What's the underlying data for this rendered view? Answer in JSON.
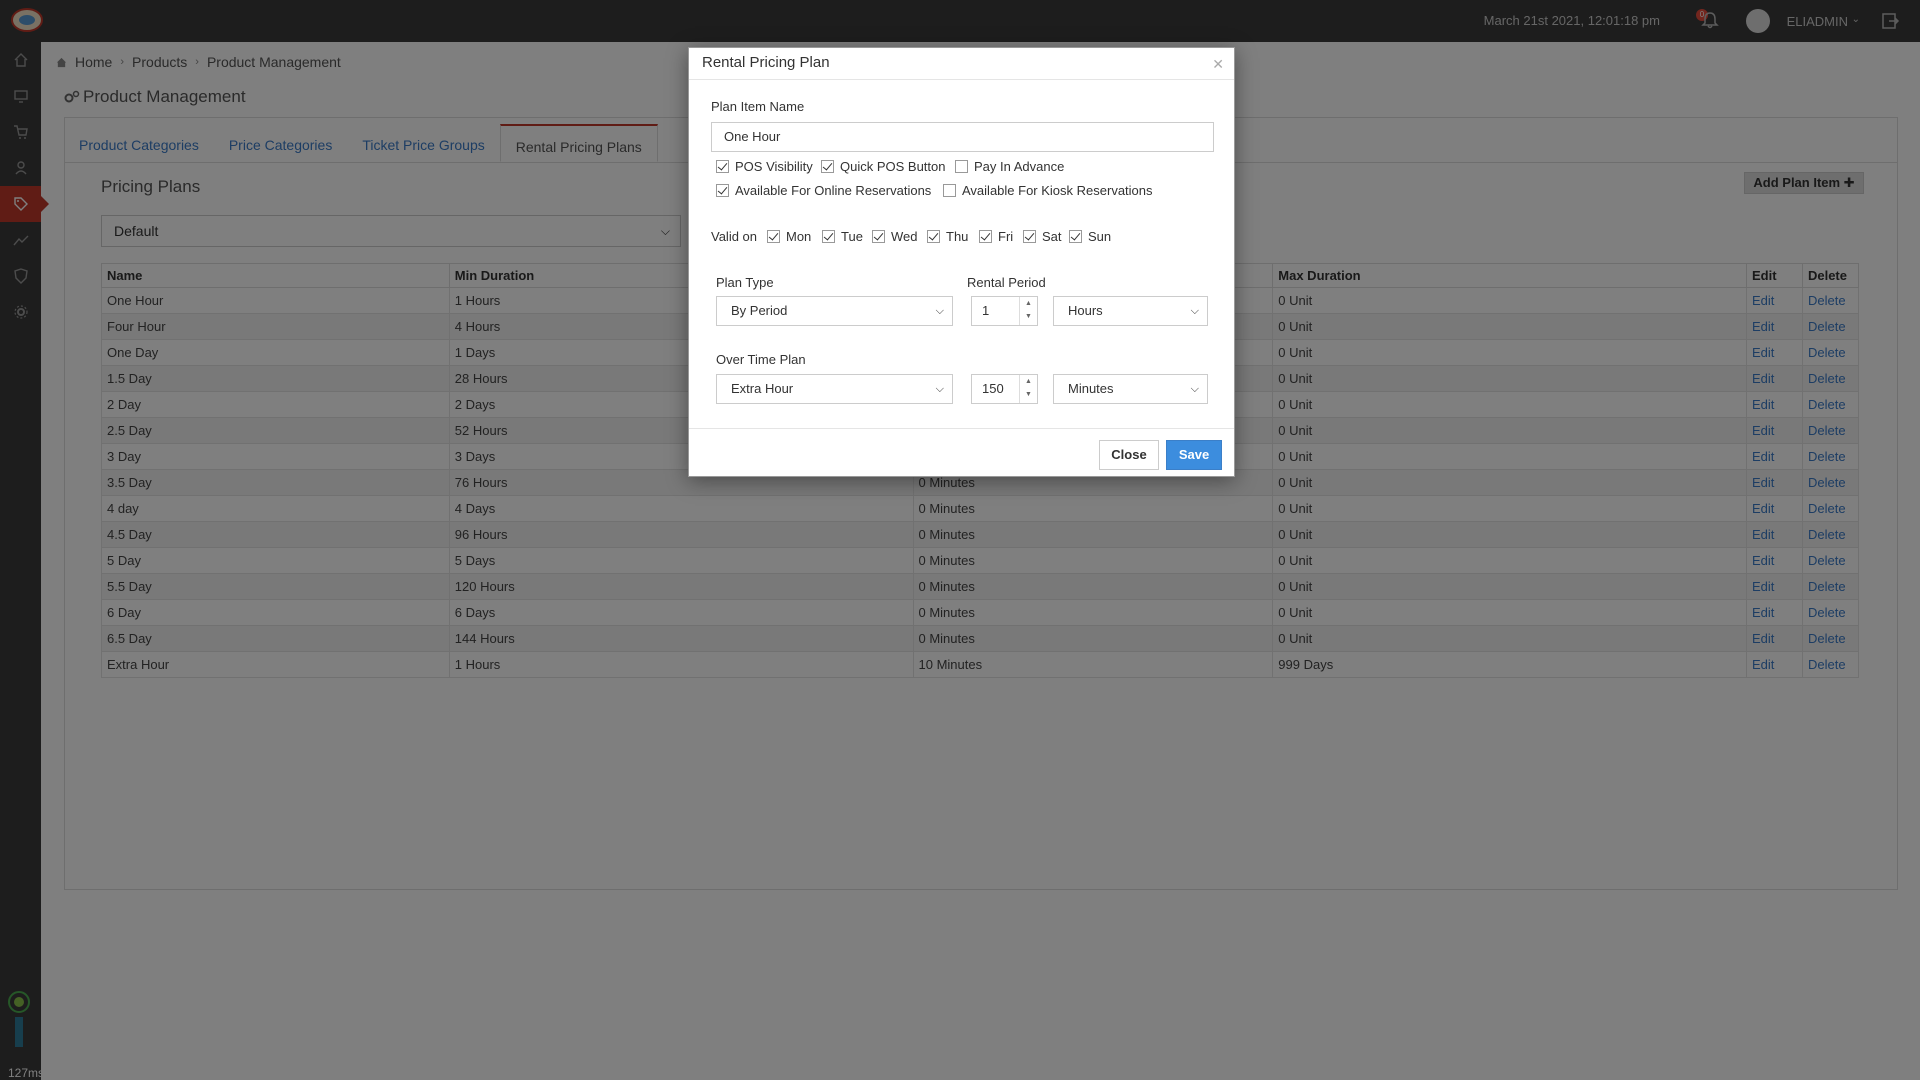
{
  "topbar": {
    "datetime": "March 21st 2021, 12:01:18 pm",
    "notification_count": "0",
    "username": "ELIADMIN"
  },
  "sidebar": {
    "items": [
      "home-icon",
      "monitor-icon",
      "cart-icon",
      "people-icon",
      "tag-icon",
      "chart-icon",
      "shield-icon",
      "gear-icon"
    ],
    "active_index": 4,
    "timing": "127ms",
    "help": "?"
  },
  "breadcrumb": [
    "Home",
    "Products",
    "Product Management"
  ],
  "page_title": "Product Management",
  "tabs": [
    "Product Categories",
    "Price Categories",
    "Ticket Price Groups",
    "Rental Pricing Plans"
  ],
  "active_tab": "Rental Pricing Plans",
  "section_title": "Pricing Plans",
  "add_plan_label": "Add Plan Item",
  "pricing_plan_select": "Default",
  "table": {
    "headers": [
      "Name",
      "Min Duration",
      "",
      "Max Duration",
      "Edit",
      "Delete"
    ],
    "rows": [
      [
        "One Hour",
        "1 Hours",
        "",
        "0 Unit"
      ],
      [
        "Four Hour",
        "4 Hours",
        "",
        "0 Unit"
      ],
      [
        "One Day",
        "1 Days",
        "",
        "0 Unit"
      ],
      [
        "1.5 Day",
        "28 Hours",
        "",
        "0 Unit"
      ],
      [
        "2 Day",
        "2 Days",
        "",
        "0 Unit"
      ],
      [
        "2.5 Day",
        "52 Hours",
        "",
        "0 Unit"
      ],
      [
        "3 Day",
        "3 Days",
        "",
        "0 Unit"
      ],
      [
        "3.5 Day",
        "76 Hours",
        "0 Minutes",
        "0 Unit"
      ],
      [
        "4 day",
        "4 Days",
        "0 Minutes",
        "0 Unit"
      ],
      [
        "4.5 Day",
        "96 Hours",
        "0 Minutes",
        "0 Unit"
      ],
      [
        "5 Day",
        "5 Days",
        "0 Minutes",
        "0 Unit"
      ],
      [
        "5.5 Day",
        "120 Hours",
        "0 Minutes",
        "0 Unit"
      ],
      [
        "6 Day",
        "6 Days",
        "0 Minutes",
        "0 Unit"
      ],
      [
        "6.5 Day",
        "144 Hours",
        "0 Minutes",
        "0 Unit"
      ],
      [
        "Extra Hour",
        "1 Hours",
        "10 Minutes",
        "999 Days"
      ]
    ],
    "edit_label": "Edit",
    "delete_label": "Delete"
  },
  "modal": {
    "title": "Rental Pricing Plan",
    "plan_item_name_label": "Plan Item Name",
    "plan_item_name_value": "One Hour",
    "checkboxes": [
      {
        "label": "POS Visibility",
        "checked": true
      },
      {
        "label": "Quick POS Button",
        "checked": true
      },
      {
        "label": "Pay In Advance",
        "checked": false
      },
      {
        "label": "Available For Online Reservations",
        "checked": true
      },
      {
        "label": "Available For Kiosk Reservations",
        "checked": false
      }
    ],
    "valid_on_label": "Valid on",
    "days": [
      {
        "label": "Mon",
        "checked": true
      },
      {
        "label": "Tue",
        "checked": true
      },
      {
        "label": "Wed",
        "checked": true
      },
      {
        "label": "Thu",
        "checked": true
      },
      {
        "label": "Fri",
        "checked": true
      },
      {
        "label": "Sat",
        "checked": true
      },
      {
        "label": "Sun",
        "checked": true
      }
    ],
    "plan_type_label": "Plan Type",
    "plan_type_value": "By Period",
    "rental_period_label": "Rental Period",
    "rental_period_value": "1",
    "rental_period_unit": "Hours",
    "over_time_plan_label": "Over Time Plan",
    "over_time_plan_value": "Extra Hour",
    "over_time_value": "150",
    "over_time_unit": "Minutes",
    "close_label": "Close",
    "save_label": "Save"
  }
}
